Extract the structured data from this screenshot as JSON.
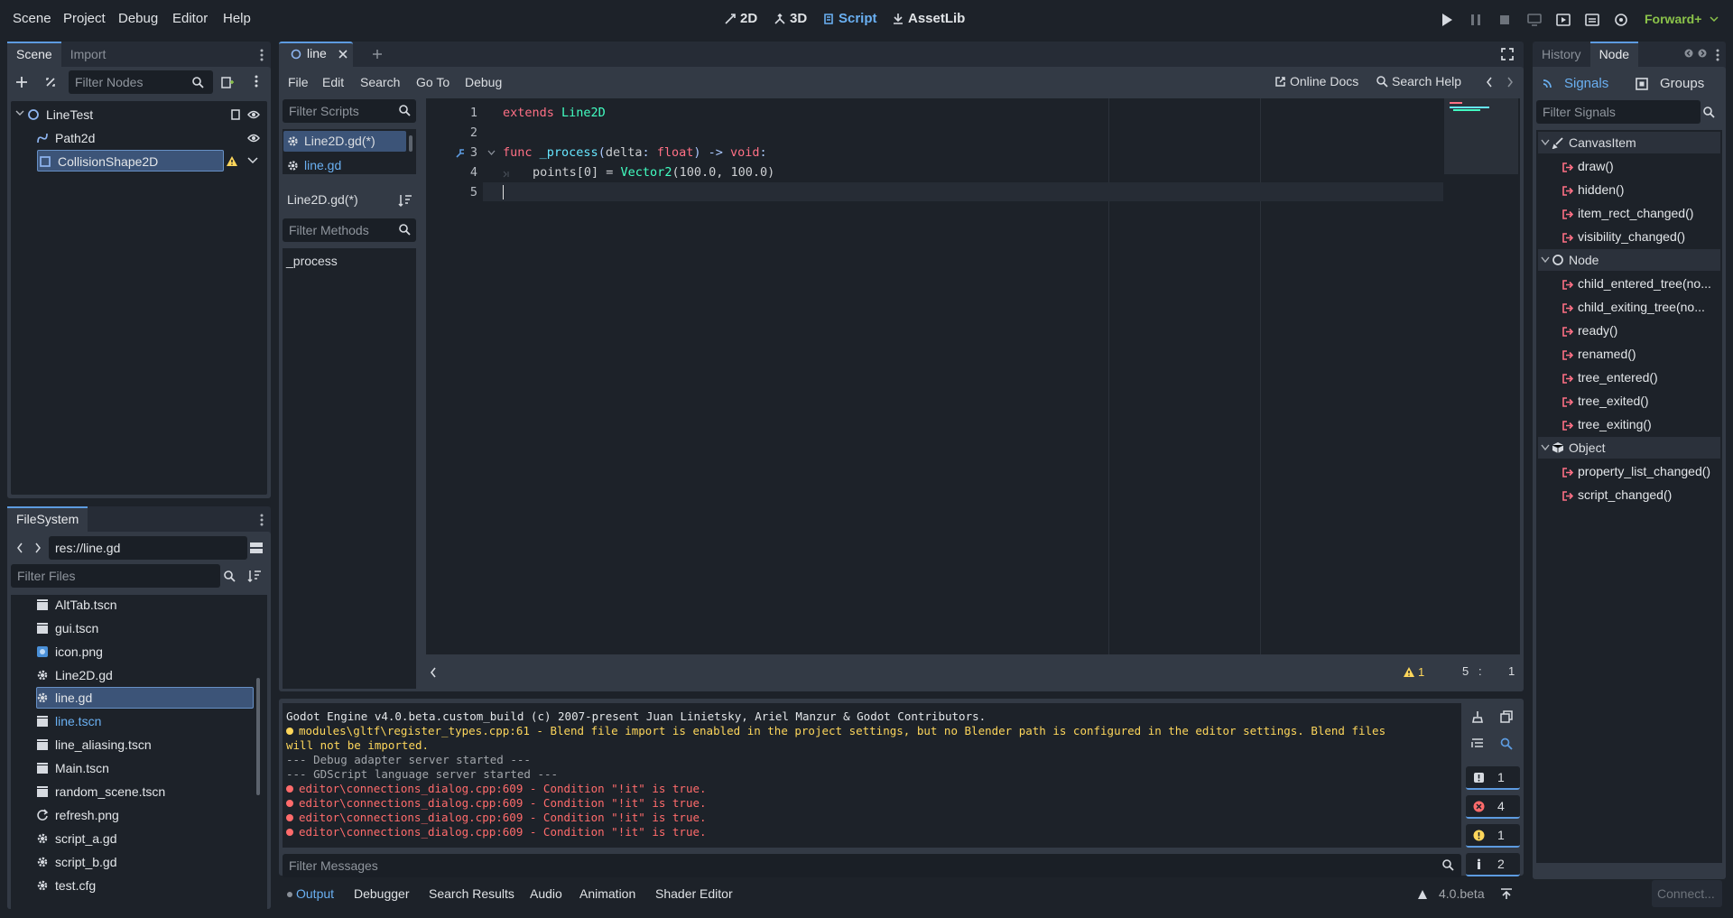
{
  "menubar": {
    "items": [
      "Scene",
      "Project",
      "Debug",
      "Editor",
      "Help"
    ]
  },
  "workspaces": [
    {
      "label": "2D",
      "active": false
    },
    {
      "label": "3D",
      "active": false
    },
    {
      "label": "Script",
      "active": true
    },
    {
      "label": "AssetLib",
      "active": false
    }
  ],
  "renderer": "Forward+",
  "scene_dock": {
    "tabs": [
      "Scene",
      "Import"
    ],
    "filter_placeholder": "Filter Nodes",
    "nodes": [
      {
        "label": "LineTest",
        "icon": "node2d-circle-icon"
      },
      {
        "label": "Path2d",
        "icon": "path2d-icon"
      },
      {
        "label": "CollisionShape2D",
        "icon": "collision-shape-icon",
        "warning": true
      }
    ]
  },
  "filesystem": {
    "tab": "FileSystem",
    "path": "res://line.gd",
    "filter_placeholder": "Filter Files",
    "files": [
      {
        "name": "AltTab.tscn",
        "icon": "scene-icon"
      },
      {
        "name": "gui.tscn",
        "icon": "scene-icon"
      },
      {
        "name": "icon.png",
        "icon": "image-icon"
      },
      {
        "name": "Line2D.gd",
        "icon": "gear-icon"
      },
      {
        "name": "line.gd",
        "icon": "gear-icon",
        "selected": true
      },
      {
        "name": "line.tscn",
        "icon": "scene-icon",
        "highlight": true
      },
      {
        "name": "line_aliasing.tscn",
        "icon": "scene-icon"
      },
      {
        "name": "Main.tscn",
        "icon": "scene-icon"
      },
      {
        "name": "random_scene.tscn",
        "icon": "scene-icon"
      },
      {
        "name": "refresh.png",
        "icon": "refresh-icon"
      },
      {
        "name": "script_a.gd",
        "icon": "gear-icon"
      },
      {
        "name": "script_b.gd",
        "icon": "gear-icon"
      },
      {
        "name": "test.cfg",
        "icon": "gear-icon"
      }
    ]
  },
  "editor": {
    "scene_tab": "line",
    "menu": [
      "File",
      "Edit",
      "Search",
      "Go To",
      "Debug"
    ],
    "online_docs": "Online Docs",
    "search_help": "Search Help",
    "filter_scripts": "Filter Scripts",
    "scripts": [
      {
        "name": "Line2D.gd(*)",
        "selected": true
      },
      {
        "name": "line.gd",
        "selected": false
      }
    ],
    "current_script": "Line2D.gd(*)",
    "filter_methods": "Filter Methods",
    "methods": [
      "_process"
    ],
    "line_numbers": [
      "1",
      "2",
      "3",
      "4",
      "5"
    ],
    "code": {
      "l1_kw": "extends",
      "l1_type": "Line2D",
      "l3_kw": "func",
      "l3_name": "_process",
      "l3_open": "(",
      "l3_arg": "delta",
      "l3_colon": ": ",
      "l3_type": "float",
      "l3_close": ") -> ",
      "l3_ret": "void",
      "l3_end": ":",
      "l4_a": "points[0] = ",
      "l4_type": "Vector2",
      "l4_b": "(100.0, 100.0)"
    },
    "status_warnings": "1",
    "cursor_line": "5",
    "cursor_sep": ":",
    "cursor_col": "1"
  },
  "output": {
    "lines": [
      {
        "text": "Godot Engine v4.0.beta.custom_build (c) 2007-present Juan Linietsky, Ariel Manzur & Godot Contributors.",
        "kind": "info"
      },
      {
        "text": "modules\\gltf\\register_types.cpp:61 - Blend file import is enabled in the project settings, but no Blender path is configured in the editor settings. Blend files",
        "kind": "warning"
      },
      {
        "text": "will not be imported.",
        "kind": "warning-cont"
      },
      {
        "text": "--- Debug adapter server started ---",
        "kind": "muted"
      },
      {
        "text": "--- GDScript language server started ---",
        "kind": "muted"
      },
      {
        "text": "editor\\connections_dialog.cpp:609 - Condition \"!it\" is true.",
        "kind": "error"
      },
      {
        "text": "editor\\connections_dialog.cpp:609 - Condition \"!it\" is true.",
        "kind": "error"
      },
      {
        "text": "editor\\connections_dialog.cpp:609 - Condition \"!it\" is true.",
        "kind": "error"
      },
      {
        "text": "editor\\connections_dialog.cpp:609 - Condition \"!it\" is true.",
        "kind": "error"
      }
    ],
    "filter_placeholder": "Filter Messages",
    "counts": {
      "errors_total": "1",
      "errors": "4",
      "warnings": "1",
      "info": "2"
    }
  },
  "bottom_tabs": [
    "Output",
    "Debugger",
    "Search Results",
    "Audio",
    "Animation",
    "Shader Editor"
  ],
  "version": "4.0.beta",
  "right_dock": {
    "tabs": [
      "History",
      "Node"
    ],
    "subtabs": [
      "Signals",
      "Groups"
    ],
    "filter_placeholder": "Filter Signals",
    "groups": [
      {
        "name": "CanvasItem",
        "signals": [
          "draw()",
          "hidden()",
          "item_rect_changed()",
          "visibility_changed()"
        ]
      },
      {
        "name": "Node",
        "signals": [
          "child_entered_tree(no...",
          "child_exiting_tree(no...",
          "ready()",
          "renamed()",
          "tree_entered()",
          "tree_exited()",
          "tree_exiting()"
        ]
      },
      {
        "name": "Object",
        "signals": [
          "property_list_changed()",
          "script_changed()"
        ]
      }
    ],
    "connect_label": "Connect..."
  },
  "colors": {
    "accent": "#5d9be0",
    "warning": "#fdd65b",
    "error": "#ff6b6b",
    "keyword": "#ff7085",
    "type": "#42ffc2",
    "function": "#66e6ff"
  }
}
